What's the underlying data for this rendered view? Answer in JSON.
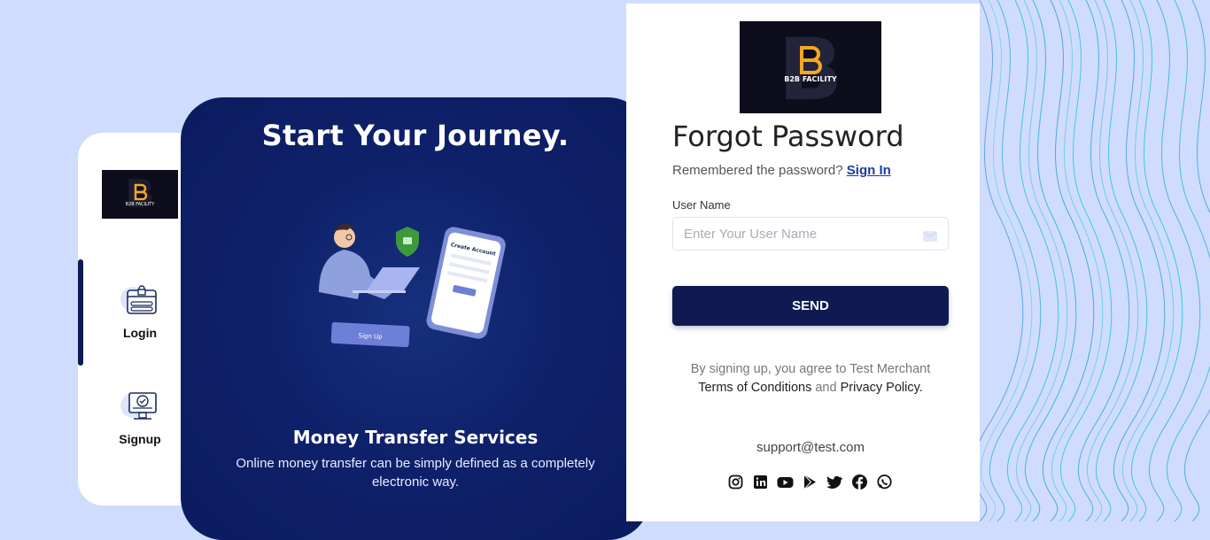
{
  "sidebar": {
    "items": [
      {
        "label": "Login",
        "icon": "login-icon"
      },
      {
        "label": "Signup",
        "icon": "signup-icon"
      }
    ]
  },
  "promo": {
    "title": "Start Your Journey.",
    "subtitle": "Money Transfer Services",
    "description": "Online money transfer can be simply defined as a completely electronic way.",
    "illustration": {
      "card_title": "Create Account",
      "button_label": "Sign Up"
    }
  },
  "form": {
    "title": "Forgot Password",
    "remember_text": "Remembered the password?",
    "sign_in_link": "Sign In",
    "username_label": "User Name",
    "username_placeholder": "Enter Your User Name",
    "username_value": "",
    "send_label": "SEND",
    "terms_prefix": "By signing up, you agree to Test Merchant",
    "terms_link": "Terms of Conditions",
    "terms_and": "and",
    "privacy_link": "Privacy Policy.",
    "support_email": "support@test.com",
    "social": [
      "instagram-icon",
      "linkedin-icon",
      "youtube-icon",
      "play-store-icon",
      "twitter-icon",
      "facebook-icon",
      "whatsapp-icon"
    ]
  },
  "brand": {
    "logo_text": "B2B FACILITY"
  },
  "colors": {
    "background": "#d0dcfd",
    "navy": "#0f1a52",
    "promo_blue": "#0f216b",
    "link": "#1a3aa8",
    "logo_orange": "#f5a623"
  }
}
